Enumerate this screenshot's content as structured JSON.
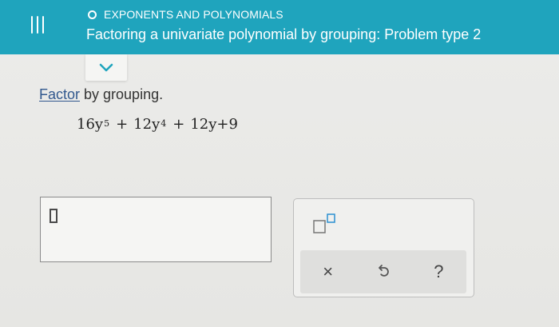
{
  "header": {
    "topic": "EXPONENTS AND POLYNOMIALS",
    "title": "Factoring a univariate polynomial by grouping: Problem type 2",
    "background": "#1fa4bd",
    "text_color": "#ffffff",
    "menu_icon": "hamburger-menu-icon",
    "topic_icon": "circle-icon"
  },
  "collapse_tab": {
    "icon": "chevron-down-icon"
  },
  "problem": {
    "instruction_link": "Factor",
    "instruction_rest": " by grouping.",
    "expression": {
      "term1_coef": "16y",
      "term1_exp": "5",
      "plus1": "+",
      "term2_coef": "12y",
      "term2_exp": "4",
      "plus2": "+",
      "term3": "12y",
      "plus3": "+",
      "term4": "9"
    }
  },
  "answer": {
    "placeholder_icon": "empty-box-icon"
  },
  "tools": {
    "exponent_icon": "exponent-template-icon",
    "clear_label": "×",
    "undo_icon": "undo-icon",
    "help_label": "?"
  },
  "colors": {
    "link": "#31588e",
    "page_background": "#e9e9e7",
    "panel_background": "#f0f0ee",
    "action_bar": "#dfdfdd"
  }
}
